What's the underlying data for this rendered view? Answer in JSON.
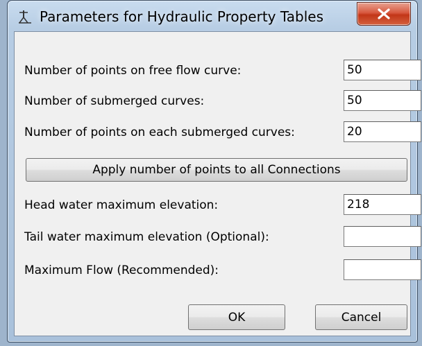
{
  "window": {
    "title": "Parameters for Hydraulic Property Tables",
    "icon": "hydraulic-structure-icon",
    "close_icon": "close-x-icon",
    "close_color": "#c9432a"
  },
  "fields": {
    "free_flow_points": {
      "label": "Number of points on free flow curve:",
      "value": "50"
    },
    "submerged_curves": {
      "label": "Number of submerged curves:",
      "value": "50"
    },
    "points_each_submerged": {
      "label": "Number of points on each submerged curves:",
      "value": "20"
    },
    "head_water_max": {
      "label": "Head water maximum elevation:",
      "value": "218"
    },
    "tail_water_max": {
      "label": "Tail water maximum elevation (Optional):",
      "value": ""
    },
    "maximum_flow": {
      "label": "Maximum Flow (Recommended):",
      "value": ""
    }
  },
  "buttons": {
    "apply_all": "Apply number of points to all Connections",
    "ok": "OK",
    "cancel": "Cancel"
  }
}
